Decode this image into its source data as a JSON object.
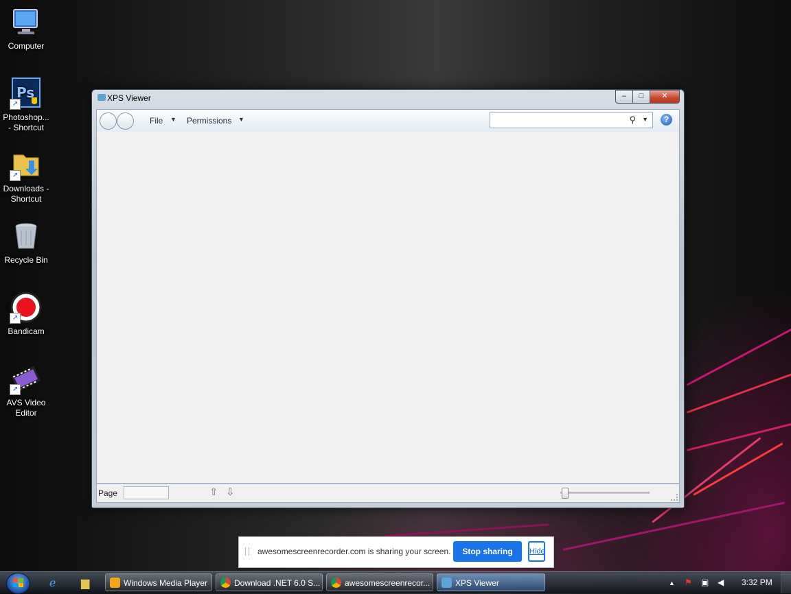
{
  "desktop": {
    "icons": [
      {
        "label_line1": "Computer",
        "label_line2": ""
      },
      {
        "label_line1": "Photoshop...",
        "label_line2": "- Shortcut"
      },
      {
        "label_line1": "Downloads -",
        "label_line2": "Shortcut"
      },
      {
        "label_line1": "Recycle Bin",
        "label_line2": ""
      },
      {
        "label_line1": "Bandicam",
        "label_line2": ""
      },
      {
        "label_line1": "AVS Video",
        "label_line2": "Editor"
      }
    ]
  },
  "window": {
    "title": "XPS Viewer",
    "caption_min": "–",
    "caption_max": "□",
    "caption_close": "✕",
    "menu_file": "File",
    "menu_permissions": "Permissions",
    "search_value": "",
    "help_glyph": "?",
    "status": {
      "page_label": "Page",
      "page_value": "",
      "zoom_level": 0.02
    }
  },
  "sharebar": {
    "message": "awesomescreenrecorder.com is sharing your screen.",
    "stop_label": "Stop sharing",
    "hide_label": "Hide"
  },
  "taskbar": {
    "tasks": [
      {
        "label": "Windows Media Player"
      },
      {
        "label": "Download .NET 6.0 S..."
      },
      {
        "label": "awesomescreenrecor..."
      },
      {
        "label": "XPS Viewer"
      }
    ],
    "clock": "3:32 PM"
  },
  "colors": {
    "accent": "#1a73e8",
    "close_button": "#c7452c",
    "content_bg": "#f0f0f0"
  }
}
